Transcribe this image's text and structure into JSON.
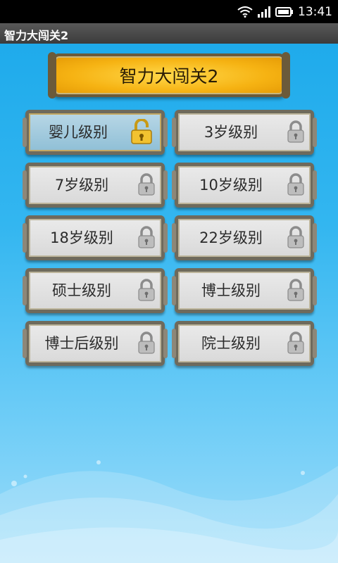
{
  "status_bar": {
    "time": "13:41"
  },
  "app_bar": {
    "title": "智力大闯关2"
  },
  "header": {
    "title": "智力大闯关2"
  },
  "levels": [
    {
      "label": "婴儿级别",
      "locked": false
    },
    {
      "label": "3岁级别",
      "locked": true
    },
    {
      "label": "7岁级别",
      "locked": true
    },
    {
      "label": "10岁级别",
      "locked": true
    },
    {
      "label": "18岁级别",
      "locked": true
    },
    {
      "label": "22岁级别",
      "locked": true
    },
    {
      "label": "硕士级别",
      "locked": true
    },
    {
      "label": "博士级别",
      "locked": true
    },
    {
      "label": "博士后级别",
      "locked": true
    },
    {
      "label": "院士级别",
      "locked": true
    }
  ],
  "colors": {
    "background": "#33b6f0",
    "banner": "#f6b313",
    "button_locked": "#d9d9d9",
    "button_unlocked": "#8fbfd6"
  }
}
